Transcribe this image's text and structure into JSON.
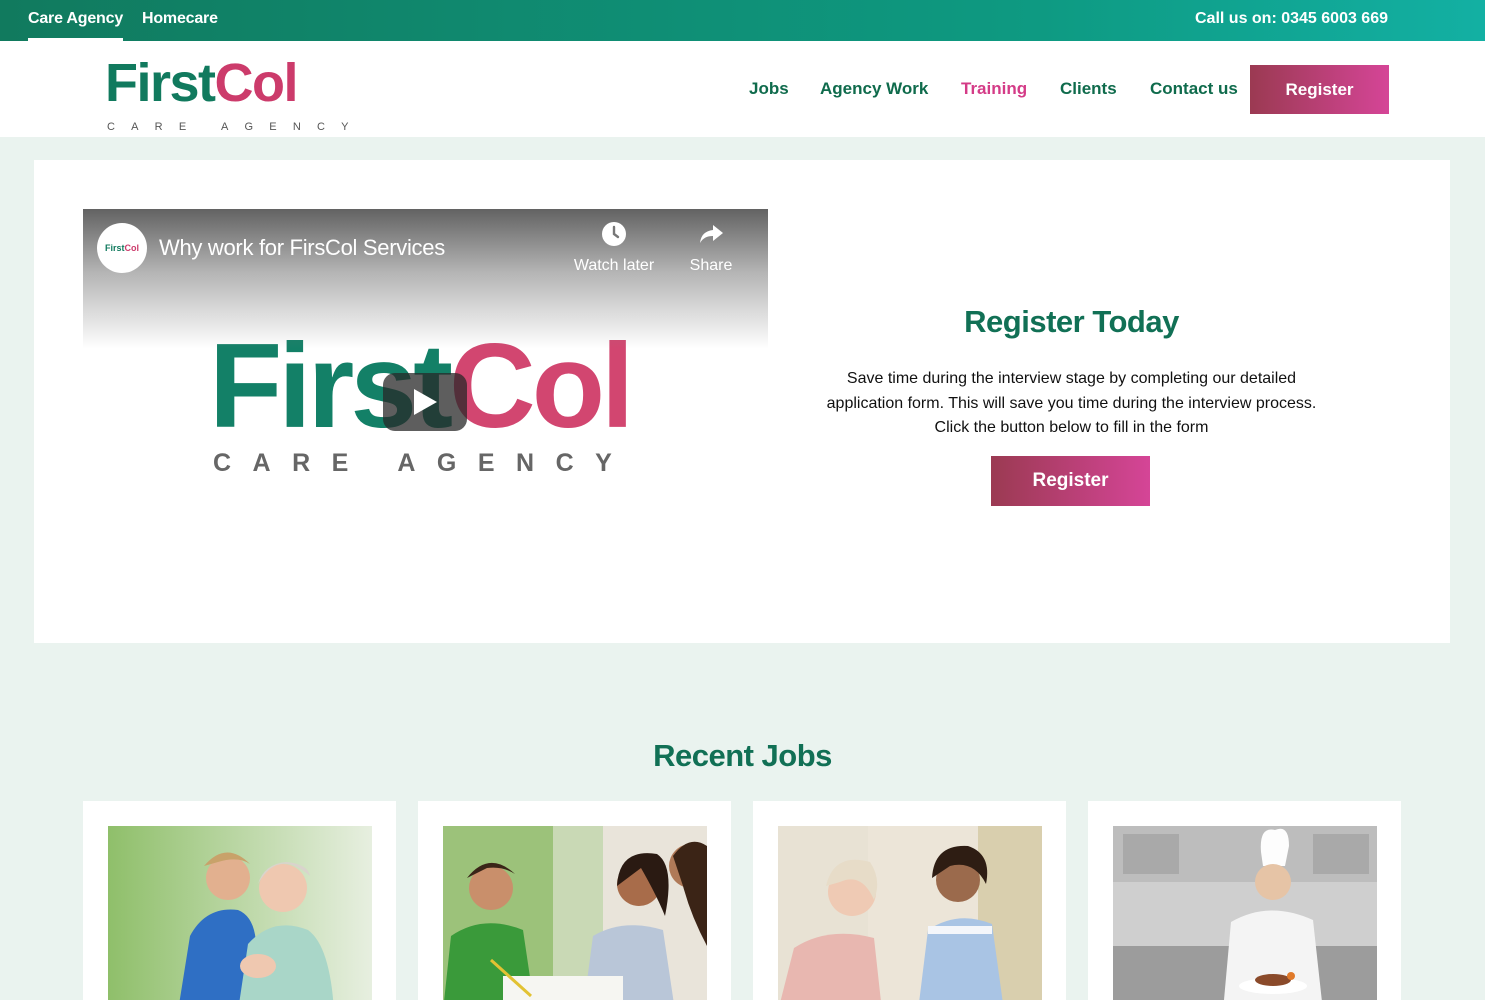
{
  "topbar": {
    "tabs": [
      {
        "label": "Care Agency",
        "active": true
      },
      {
        "label": "Homecare",
        "active": false
      }
    ],
    "phone": "Call us on: 0345 6003 669"
  },
  "header": {
    "logo": {
      "first": "First",
      "col": "Col",
      "sub": "CARE AGENCY"
    },
    "nav": [
      "Jobs",
      "Agency Work",
      "Training",
      "Clients",
      "Contact us"
    ],
    "nav_highlight": "Training",
    "register_label": "Register"
  },
  "hero": {
    "video": {
      "channel_first": "First",
      "channel_col": "Col",
      "title": "Why work for FirsCol Services",
      "watch_later": "Watch later",
      "share": "Share",
      "logo_first": "First",
      "logo_col": "Col",
      "logo_sub": "CARE AGENCY"
    },
    "register": {
      "heading": "Register Today",
      "body": "Save time during the interview stage by completing our detailed application form. This will save you time during the interview process. Click the button below to fill in the form",
      "button": "Register"
    }
  },
  "recent_jobs": {
    "title": "Recent Jobs"
  },
  "colors": {
    "brand_green": "#117a5e",
    "brand_pink": "#cc3b6b",
    "button_gradient_start": "#9b3a52",
    "button_gradient_end": "#d54597",
    "page_background": "#eaf3ef"
  }
}
